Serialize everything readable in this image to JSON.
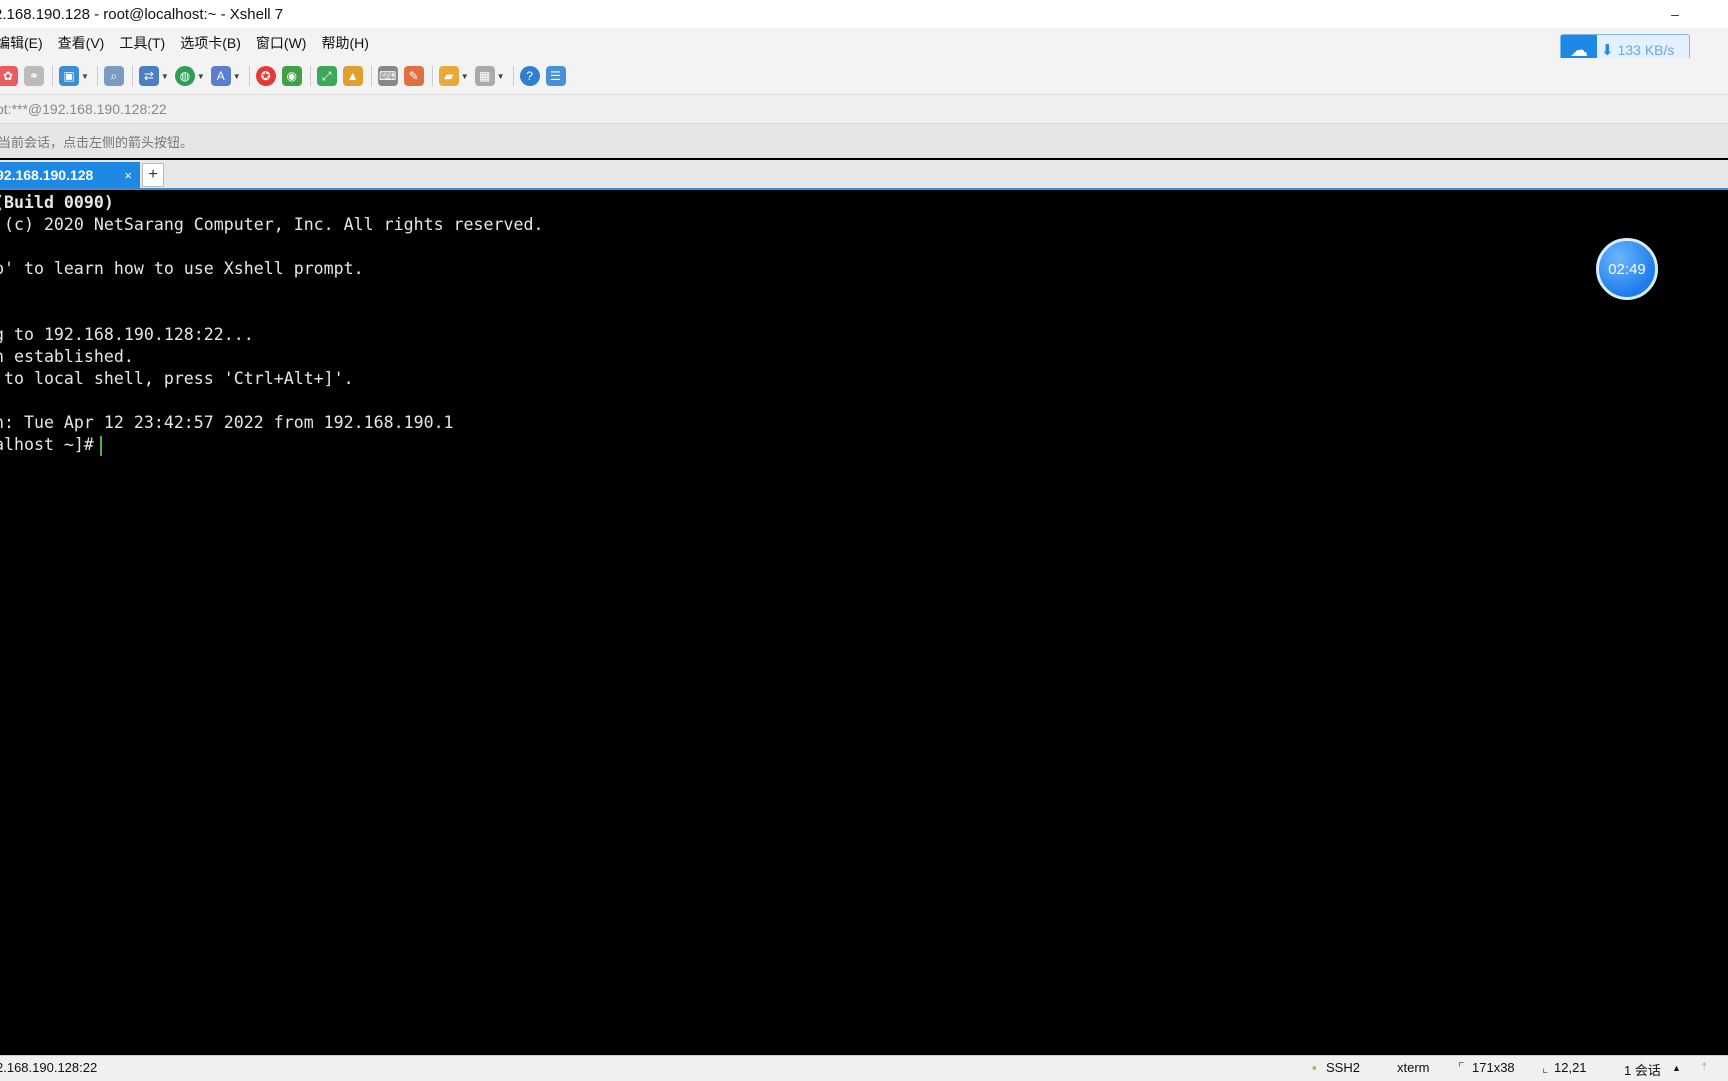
{
  "window": {
    "title": "2.168.190.128 - root@localhost:~ - Xshell 7",
    "minimize_label": "–",
    "close_label": "✕"
  },
  "menu": [
    "编辑(E)",
    "查看(V)",
    "工具(T)",
    "选项卡(B)",
    "窗口(W)",
    "帮助(H)"
  ],
  "toolbar": {
    "icons": [
      "properties-icon",
      "disconnect-icon",
      "new-session-icon",
      "find-icon",
      "transfer-icon",
      "globe-icon",
      "font-icon",
      "xftp-icon",
      "xmanager-icon",
      "fullscreen-icon",
      "lock-icon",
      "keyboard-icon",
      "script-icon",
      "folder-icon",
      "layout-icon",
      "help-icon",
      "chat-icon"
    ]
  },
  "address": {
    "value": "ot:***@192.168.190.128:22"
  },
  "hint": {
    "text": "当前会话，点击左侧的箭头按钮。"
  },
  "tabs": [
    {
      "label": "92.168.190.128",
      "close": "×"
    }
  ],
  "add_tab_label": "+",
  "net_speed": {
    "value": "133 KB/s",
    "arrow": "⬇"
  },
  "timer": {
    "value": "02:49"
  },
  "terminal": {
    "lines": [
      " (Build 0090)",
      "t (c) 2020 NetSarang Computer, Inc. All rights reserved.",
      "",
      "lp' to learn how to use Xshell prompt.",
      "",
      "",
      "ng to 192.168.190.128:22...",
      "on established.",
      "e to local shell, press 'Ctrl+Alt+]'.",
      "",
      "in: Tue Apr 12 23:42:57 2022 from 192.168.190.1",
      "calhost ~]#"
    ]
  },
  "status": {
    "address": "2.168.190.128:22",
    "protocol": "SSH2",
    "term": "xterm",
    "size": "171x38",
    "pos": "12,21",
    "sessions": "1 会话"
  }
}
